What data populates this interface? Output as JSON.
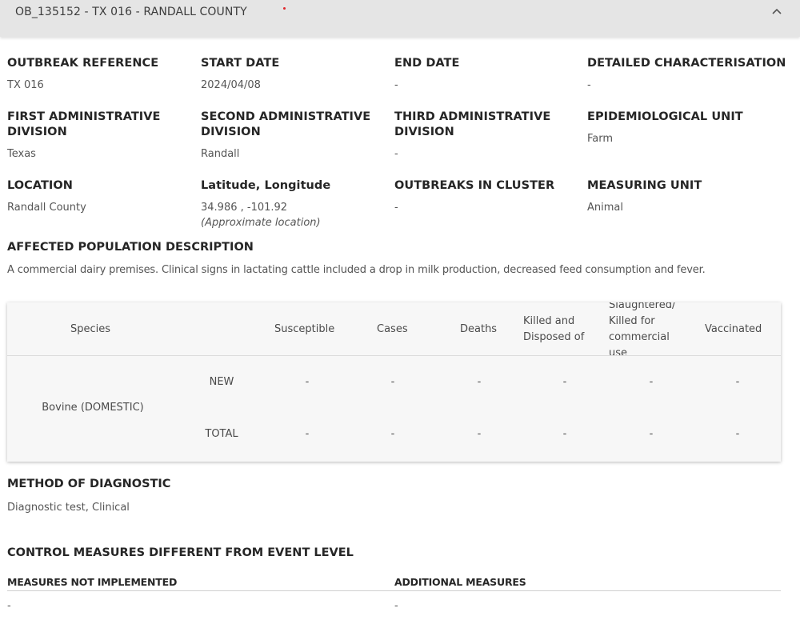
{
  "header": {
    "title": "OB_135152 - TX 016 - RANDALL COUNTY",
    "collapse_icon": "chevron-up-icon",
    "dot_color": "#e0262b"
  },
  "fields": {
    "outbreak_reference": {
      "label": "OUTBREAK REFERENCE",
      "value": "TX 016"
    },
    "start_date": {
      "label": "START DATE",
      "value": "2024/04/08"
    },
    "end_date": {
      "label": "END DATE",
      "value": "-"
    },
    "detailed_characterisation": {
      "label": "DETAILED CHARACTERISATION",
      "value": "-"
    },
    "first_admin": {
      "label": "FIRST ADMINISTRATIVE DIVISION",
      "value": "Texas"
    },
    "second_admin": {
      "label": "SECOND ADMINISTRATIVE DIVISION",
      "value": "Randall"
    },
    "third_admin": {
      "label": "THIRD ADMINISTRATIVE DIVISION",
      "value": "-"
    },
    "epi_unit": {
      "label": "EPIDEMIOLOGICAL UNIT",
      "value": "Farm"
    },
    "location": {
      "label": "LOCATION",
      "value": "Randall County"
    },
    "lat_long": {
      "label": "Latitude, Longitude",
      "value": "34.986 , -101.92",
      "note": "(Approximate location)"
    },
    "outbreaks_in_cluster": {
      "label": "OUTBREAKS IN CLUSTER",
      "value": "-"
    },
    "measuring_unit": {
      "label": "MEASURING UNIT",
      "value": "Animal"
    }
  },
  "affected_population": {
    "label": "AFFECTED POPULATION DESCRIPTION",
    "text": "A commercial dairy premises. Clinical signs in lactating cattle included a drop in milk production, decreased feed consumption and fever."
  },
  "table": {
    "headers": {
      "species": "Species",
      "susceptible": "Susceptible",
      "cases": "Cases",
      "deaths": "Deaths",
      "killed_disposed": "Killed and Disposed of",
      "slaughtered": "Slaughtered/ Killed for commercial use",
      "vaccinated": "Vaccinated"
    },
    "species": "Bovine (DOMESTIC)",
    "rows": [
      {
        "label": "NEW",
        "susceptible": "-",
        "cases": "-",
        "deaths": "-",
        "killed_disposed": "-",
        "slaughtered": "-",
        "vaccinated": "-"
      },
      {
        "label": "TOTAL",
        "susceptible": "-",
        "cases": "-",
        "deaths": "-",
        "killed_disposed": "-",
        "slaughtered": "-",
        "vaccinated": "-"
      }
    ]
  },
  "method_of_diagnostic": {
    "label": "METHOD OF DIAGNOSTIC",
    "value": "Diagnostic test, Clinical"
  },
  "control_measures": {
    "label": "CONTROL MEASURES DIFFERENT FROM EVENT LEVEL",
    "not_implemented_label": "MEASURES NOT IMPLEMENTED",
    "not_implemented_value": "-",
    "additional_label": "ADDITIONAL MEASURES",
    "additional_value": "-"
  }
}
